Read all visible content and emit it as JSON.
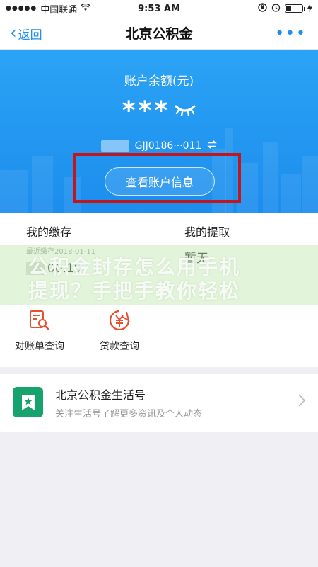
{
  "status_bar": {
    "carrier": "中国联通",
    "time": "9:53 AM"
  },
  "nav": {
    "back_label": "返回",
    "title": "北京公积金",
    "more_label": "•••"
  },
  "banner": {
    "balance_label": "账户余额(元)",
    "balance_value": "***",
    "account_number": "GJJ0186···011",
    "account_info_button": "查看账户信息"
  },
  "summary": {
    "deposit_title": "我的缴存",
    "deposit_date": "最近缴存2018-01-11",
    "deposit_value": "00.19",
    "withdraw_title": "我的提取",
    "withdraw_value": "暂无"
  },
  "watermark": {
    "line1": "公积金封存怎么用手机",
    "line2": "提现？手把手教你轻松"
  },
  "services": [
    {
      "label": "对账单查询",
      "icon": "statement-search-icon"
    },
    {
      "label": "贷款查询",
      "icon": "loan-query-icon"
    }
  ],
  "life": {
    "title": "北京公积金生活号",
    "subtitle": "关注生活号了解更多资讯及个人动态"
  },
  "colors": {
    "accent": "#1e8ef0",
    "banner": "#2196f3",
    "highlight": "#c0161e",
    "service_icon": "#e94e2e",
    "life_icon": "#17a36e"
  }
}
